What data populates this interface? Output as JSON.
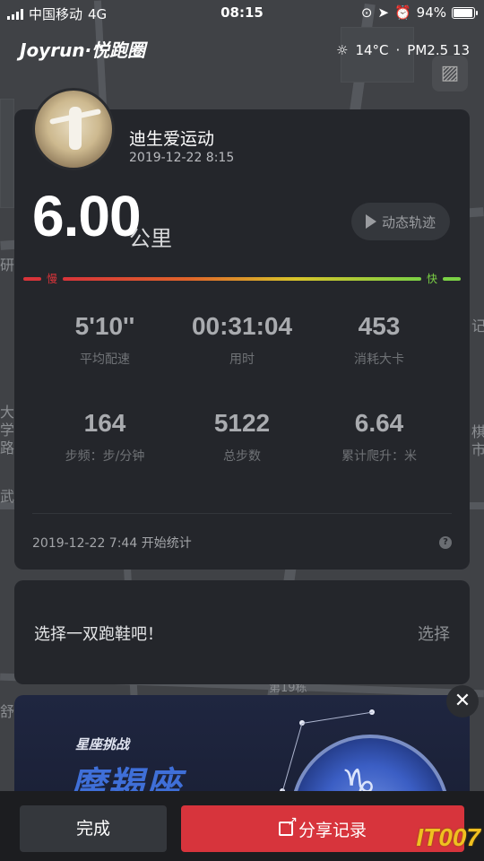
{
  "status_bar": {
    "carrier": "中国移动",
    "network": "4G",
    "time": "08:15",
    "battery": "94%"
  },
  "header": {
    "brand": "Joyrun·悦跑圈",
    "temperature": "14°C",
    "separator": "·",
    "air_quality": "PM2.5 13"
  },
  "map_labels": [
    "研",
    "大",
    "学",
    "路",
    "武",
    "舒",
    "第19栋",
    "记",
    "棋",
    "市"
  ],
  "run": {
    "username": "迪生爱运动",
    "datetime": "2019-12-22 8:15",
    "distance": "6.00",
    "distance_unit": "公里",
    "track_button": "动态轨迹",
    "speed_slow": "慢",
    "speed_fast": "快",
    "stats": [
      {
        "value": "5'10''",
        "label": "平均配速"
      },
      {
        "value": "00:31:04",
        "label": "用时"
      },
      {
        "value": "453",
        "label": "消耗大卡"
      },
      {
        "value": "164",
        "label": "步频：步/分钟"
      },
      {
        "value": "5122",
        "label": "总步数"
      },
      {
        "value": "6.64",
        "label": "累计爬升：米"
      }
    ],
    "start_text": "2019-12-22 7:44 开始统计",
    "help": "?"
  },
  "shoe": {
    "prompt": "选择一双跑鞋吧！",
    "select": "选择"
  },
  "promo": {
    "tag": "星座挑战",
    "title": "摩羯座",
    "mark": "♑"
  },
  "footer": {
    "done": "完成",
    "share": "分享记录",
    "watermark": "IT007"
  }
}
